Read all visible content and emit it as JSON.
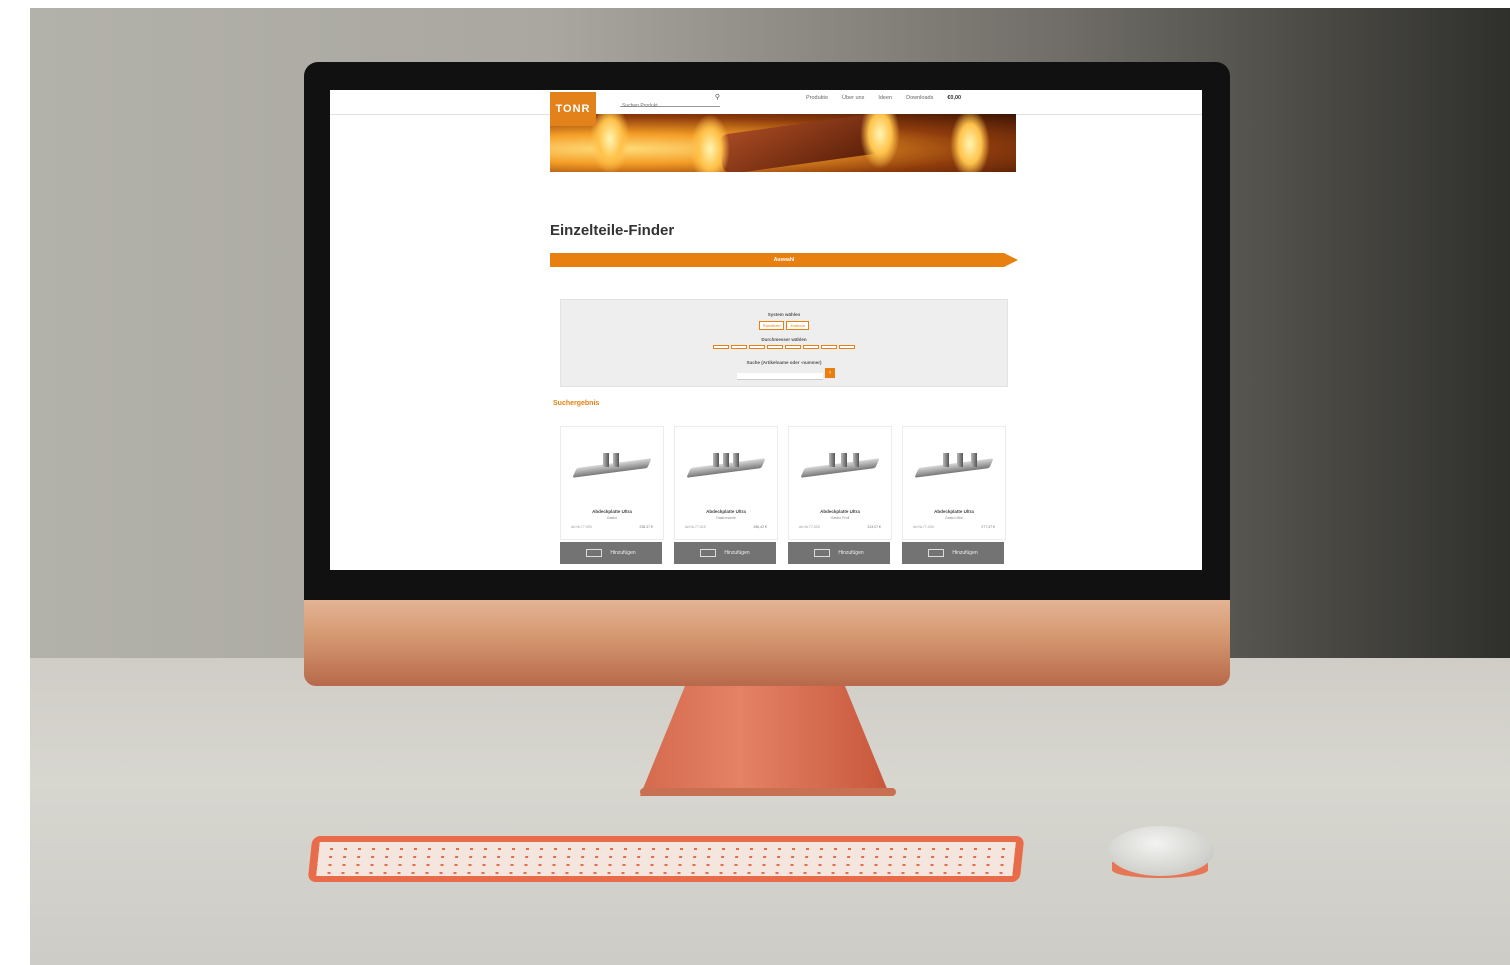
{
  "brand": {
    "logo_text": "TONR"
  },
  "nav": {
    "search_placeholder": "Suchen Produkt...",
    "items": [
      {
        "label": "Produkte"
      },
      {
        "label": "Über uns"
      },
      {
        "label": "Ideen"
      },
      {
        "label": "Downloads"
      },
      {
        "label": "€0,00"
      }
    ]
  },
  "page": {
    "title": "Einzelteile-Finder",
    "step_label": "Auswahl",
    "results_heading": "Suchergebnis"
  },
  "filter": {
    "system_label": "System wählen",
    "system_options": [
      "Rundform",
      "Eckform"
    ],
    "diameter_label": "Durchmesser wählen",
    "diameter_options": [
      "",
      "",
      "",
      "",
      "",
      "",
      "",
      ""
    ],
    "search_label": "Suche (Artikelname oder -nummer)",
    "search_button": "›"
  },
  "products": [
    {
      "name": "Abdeckplatte Ultra",
      "sub": "Gastro",
      "art": "Art.Nr.77-000",
      "price": "238,37 €"
    },
    {
      "name": "Abdeckplatte Ultra",
      "sub": "Gastronomie",
      "art": "Art.Nr.77-010",
      "price": "286,42 €"
    },
    {
      "name": "Abdeckplatte Ultra",
      "sub": "Gastro Profi",
      "art": "Art.Nr.77-020",
      "price": "313,07 €"
    },
    {
      "name": "Abdeckplatte Ultra",
      "sub": "Gastro Mini",
      "art": "Art.Nr.77-030",
      "price": "277,37 €"
    }
  ],
  "add_button_label": "Hinzufügen",
  "colors": {
    "accent": "#e88010",
    "button_gray": "#737373"
  }
}
